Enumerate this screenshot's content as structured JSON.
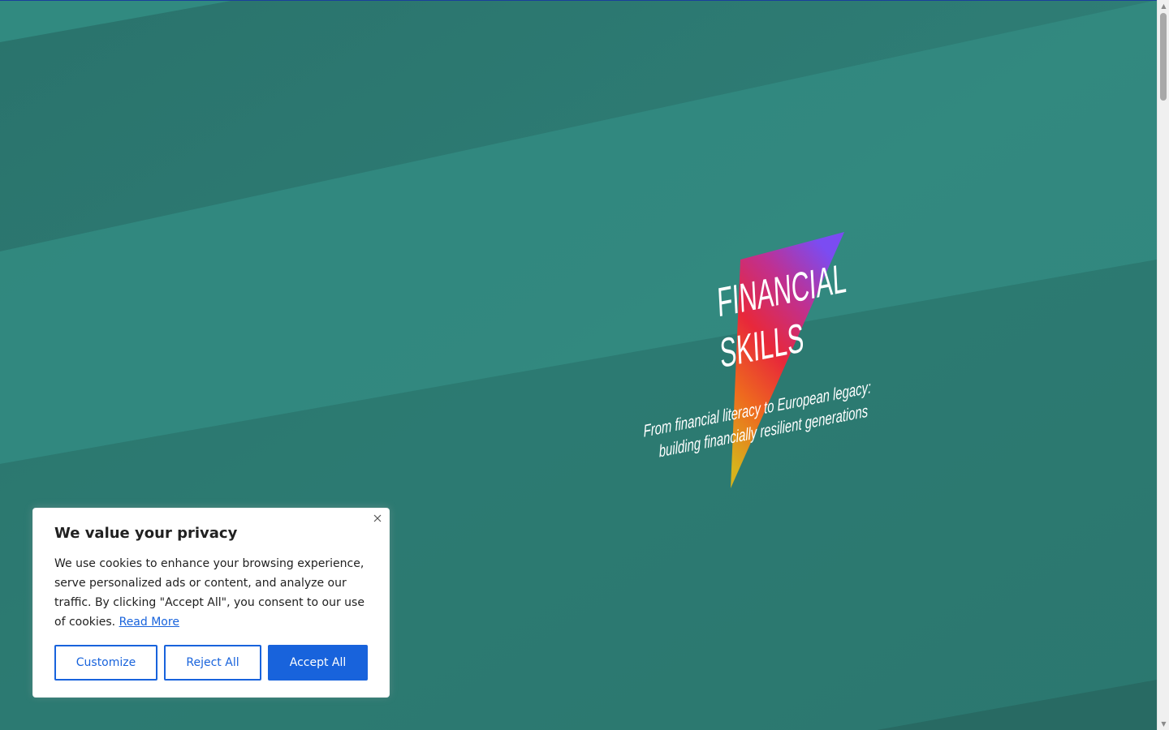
{
  "hero": {
    "logo": {
      "line1": "FINANCIAL",
      "line2": "SKILLS",
      "tagline1": "From financial literacy to European legacy:",
      "tagline2": "building financially resilient generations"
    },
    "colors": {
      "background": "#2d7a72",
      "band_dark": "#286e67",
      "band_light": "#33897f",
      "accent_top": "#1a3f9c"
    }
  },
  "cookie_banner": {
    "title": "We value your privacy",
    "text": "We use cookies to enhance your browsing experience, serve personalized ads or content, and analyze our traffic. By clicking \"Accept All\", you consent to our use of cookies.",
    "read_more": "Read More",
    "buttons": {
      "customize": "Customize",
      "reject": "Reject All",
      "accept": "Accept All"
    },
    "close_icon": "close-icon",
    "colors": {
      "primary": "#1863dc",
      "text": "#212121",
      "background": "#ffffff"
    }
  },
  "scrollbar": {
    "up_icon": "triangle-up-icon",
    "down_icon": "triangle-down-icon"
  }
}
